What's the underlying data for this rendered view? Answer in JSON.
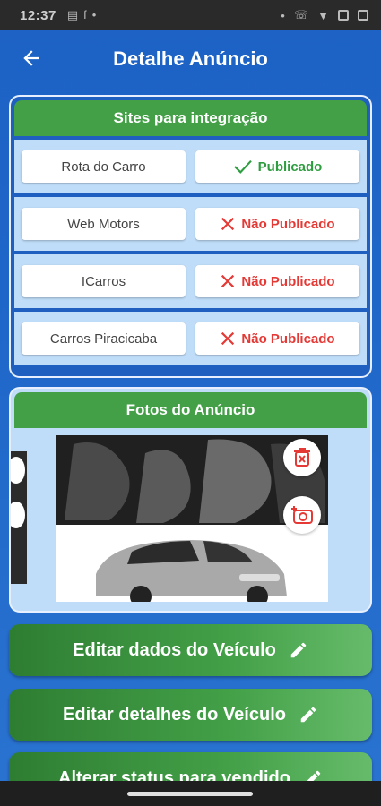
{
  "status_bar": {
    "time": "12:37"
  },
  "app_bar": {
    "title": "Detalhe Anúncio",
    "back_icon": "arrow-left-icon"
  },
  "sites_panel": {
    "title": "Sites para integração",
    "sites": [
      {
        "name": "Rota do Carro",
        "status": "Publicado",
        "published": true
      },
      {
        "name": "Web Motors",
        "status": "Não Publicado",
        "published": false
      },
      {
        "name": "ICarros",
        "status": "Não Publicado",
        "published": false
      },
      {
        "name": "Carros Piracicaba",
        "status": "Não Publicado",
        "published": false
      }
    ]
  },
  "photos_panel": {
    "title": "Fotos do Anúncio",
    "delete_icon": "trash-icon",
    "add_photo_icon": "camera-add-icon"
  },
  "actions": {
    "edit_vehicle_data": "Editar dados do Veículo",
    "edit_vehicle_details": "Editar detalhes do Veículo",
    "change_status_sold": "Alterar status para vendido"
  },
  "colors": {
    "primary_blue": "#1e62c4",
    "header_green": "#43a047",
    "published_green": "#2e9d3f",
    "unpublished_red": "#e53935"
  }
}
